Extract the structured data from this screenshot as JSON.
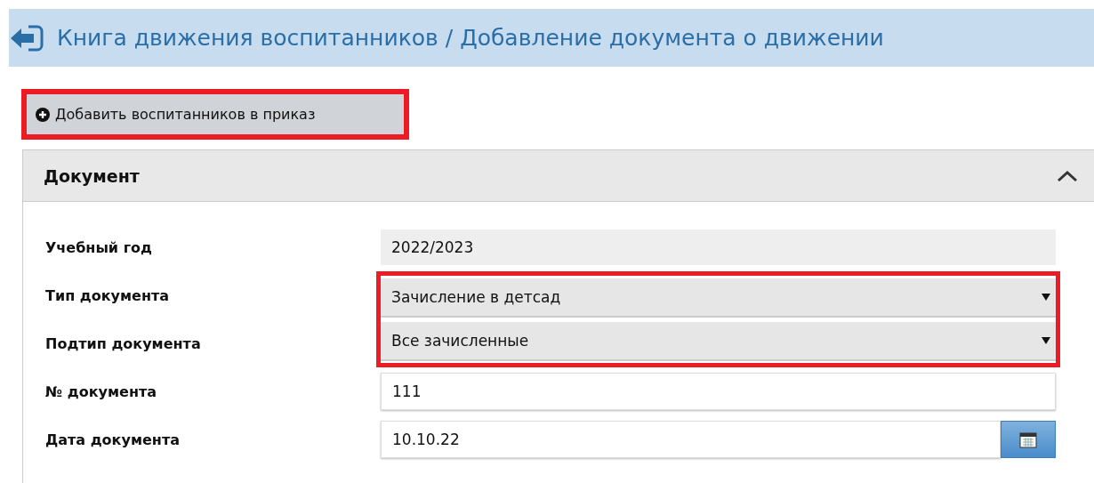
{
  "header": {
    "title": "Книга движения воспитанников / Добавление документа о движении"
  },
  "add_button": {
    "label": "Добавить воспитанников в приказ",
    "highlighted": true
  },
  "panel": {
    "title": "Документ",
    "expanded": true,
    "fields": [
      {
        "label": "Учебный год",
        "kind": "readonly",
        "value": "2022/2023",
        "highlighted": false
      },
      {
        "label": "Тип документа",
        "kind": "select",
        "value": "Зачисление в детсад",
        "highlighted": true
      },
      {
        "label": "Подтип документа",
        "kind": "select",
        "value": "Все зачисленные",
        "highlighted": true
      },
      {
        "label": "№ документа",
        "kind": "text",
        "value": "111",
        "highlighted": false
      },
      {
        "label": "Дата документа",
        "kind": "date",
        "value": "10.10.22",
        "highlighted": false
      }
    ]
  }
}
